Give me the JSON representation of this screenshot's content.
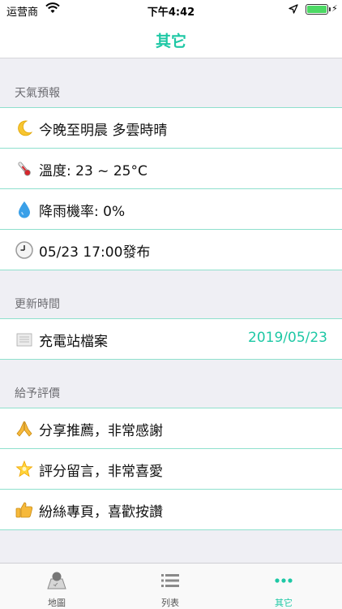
{
  "status_bar": {
    "carrier": "运营商",
    "time": "下午4:42",
    "bolt": "⚡"
  },
  "nav": {
    "title": "其它"
  },
  "sections": [
    {
      "header": "天氣預報",
      "cells": [
        {
          "icon": "crescent-moon-icon",
          "label": "今晚至明晨 多雲時晴"
        },
        {
          "icon": "thermometer-icon",
          "label": "溫度: 23 ~ 25°C"
        },
        {
          "icon": "droplet-icon",
          "label": "降雨機率: 0%"
        },
        {
          "icon": "clock-icon",
          "label": "05/23 17:00發布"
        }
      ]
    },
    {
      "header": "更新時間",
      "cells": [
        {
          "icon": "scroll-icon",
          "label": "充電站檔案",
          "value": "2019/05/23"
        }
      ]
    },
    {
      "header": "給予評價",
      "cells": [
        {
          "icon": "praying-hands-icon",
          "label": "分享推薦，非常感謝"
        },
        {
          "icon": "glowing-star-icon",
          "label": "評分留言，非常喜愛"
        },
        {
          "icon": "thumbs-up-icon",
          "label": "紛絲專頁，喜歡按讚"
        }
      ]
    }
  ],
  "tabs": [
    {
      "icon": "map-icon",
      "label": "地圖",
      "active": false
    },
    {
      "icon": "list-icon",
      "label": "列表",
      "active": false
    },
    {
      "icon": "more-dots-icon",
      "label": "其它",
      "active": true
    }
  ],
  "colors": {
    "accent": "#1ec8a5",
    "separator": "#8fe0cd",
    "background": "#efeff4"
  }
}
